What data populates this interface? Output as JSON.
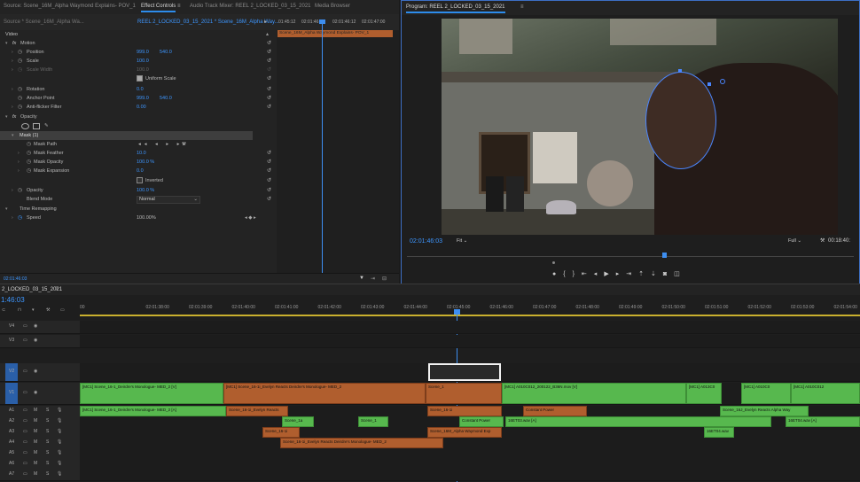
{
  "tabs": {
    "source": "Source: Scene_16M_Alpha Waymond Explains- POV_1",
    "effect_controls": "Effect Controls",
    "audio_mixer": "Audio Track Mixer: REEL 2_LOCKED_03_15_2021",
    "media_browser": "Media Browser",
    "program": "Program: REEL 2_LOCKED_03_15_2021"
  },
  "ec": {
    "source_sel": "Source * Scene_16M_Alpha Wa...",
    "sequence_sel": "REEL 2_LOCKED_03_15_2021 * Scene_16M_Alpha Way...",
    "times": [
      "01:45:12",
      "02:01:46:00",
      "02:01:46:12",
      "02:01:47:00"
    ],
    "clip_name": "Scene_16M_Alpha Waymond Explains- POV_1",
    "video_header": "Video",
    "motion": "Motion",
    "position": {
      "label": "Position",
      "x": "999.0",
      "y": "540.0"
    },
    "scale": {
      "label": "Scale",
      "value": "100.0"
    },
    "scale_width": {
      "label": "Scale Width",
      "value": "100.0"
    },
    "uniform_scale": "Uniform Scale",
    "rotation": {
      "label": "Rotation",
      "value": "0.0"
    },
    "anchor_point": {
      "label": "Anchor Point",
      "x": "999.0",
      "y": "540.0"
    },
    "anti_flicker": {
      "label": "Anti-flicker Filter",
      "value": "0.00"
    },
    "opacity_header": "Opacity",
    "mask": "Mask (1)",
    "mask_path": "Mask Path",
    "mask_feather": {
      "label": "Mask Feather",
      "value": "10.0"
    },
    "mask_opacity": {
      "label": "Mask Opacity",
      "value": "100.0 %"
    },
    "mask_expansion": {
      "label": "Mask Expansion",
      "value": "0.0"
    },
    "inverted": "Inverted",
    "opacity": {
      "label": "Opacity",
      "value": "100.0 %"
    },
    "blend_mode": {
      "label": "Blend Mode",
      "value": "Normal"
    },
    "time_remap": "Time Remapping",
    "speed": {
      "label": "Speed",
      "value": "100.00%"
    },
    "current_time": "02:01:46:03"
  },
  "pm": {
    "timecode": "02:01:46:03",
    "fit": "Fit",
    "full": "Full",
    "duration": "00:18:40:"
  },
  "tl": {
    "seq_name": "2_LOCKED_03_15_2021",
    "timecode": "1:46:03",
    "ruler": [
      "00",
      "02:01:38:00",
      "02:01:39:00",
      "02:01:40:00",
      "02:01:41:00",
      "02:01:42:00",
      "02:01:43:00",
      "02:01:44:00",
      "02:01:45:00",
      "02:01:46:00",
      "02:01:47:00",
      "02:01:48:00",
      "02:01:49:00",
      "02:01:50:00",
      "02:01:51:00",
      "02:01:52:00",
      "02:01:53:00",
      "02:01:54:00",
      "02:01:55:00"
    ],
    "tracks": [
      "V4",
      "V3",
      "V2",
      "V1",
      "A1",
      "A2",
      "A3",
      "A4",
      "A5",
      "A6",
      "A7"
    ],
    "clips": {
      "v1a": "[MC1] Scene_16-1_Deirdre's Monologue- MED_2 [V]",
      "v1b": "[MC1] Scene_16-1i_Evelyn Reacts Deirdre's Monologue- MED_2",
      "v1c": "[MC1] A010C012_200122_B36N.mov [V]",
      "v1d": "[MC1] A013C0",
      "v1e": "[MC1] A010C0",
      "v1f": "[MC1] A010C012",
      "a1a": "[MC1] Scene_16-1_Deirdre's Monologue- MED_2 [A]",
      "a1b": "Scene_16-1i_Evelyn Reacts",
      "a1c": "Scene_16-1i",
      "a1d": "Scene_16J_Evelyn Reacts Alpha Way",
      "a2a": "Scene_1a",
      "a2b": "Scene_1",
      "a2c": "16ET03.wav [A]",
      "a2d": "16ET04.wav [A]",
      "a3a": "Scene_16-1i",
      "a3b": "Scene_16M_Alpha Waymond Exp",
      "a3c": "16ET04.wav",
      "a4a": "Scene_16-1i_Evelyn Reacts Deirdre's Monologue- MED_2",
      "v1t": "Scene_1",
      "v1u": "Constant Power",
      "v1v": "Constant Power"
    }
  },
  "colors": {
    "accent": "#2d8ceb",
    "clip_green": "#57b84e",
    "clip_orange": "#b05e2e",
    "playhead": "#3d8ef0",
    "value_blue": "#3d96ff"
  }
}
